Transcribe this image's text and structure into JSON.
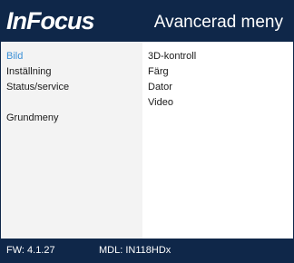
{
  "header": {
    "logo_text": "InFocus",
    "menu_title": "Avancerad meny"
  },
  "left_menu": {
    "items": [
      {
        "label": "Bild",
        "selected": true
      },
      {
        "label": "Inställning",
        "selected": false
      },
      {
        "label": "Status/service",
        "selected": false
      },
      {
        "label": "",
        "selected": false
      },
      {
        "label": "Grundmeny",
        "selected": false
      }
    ]
  },
  "right_menu": {
    "items": [
      {
        "label": "3D-kontroll"
      },
      {
        "label": "Färg"
      },
      {
        "label": "Dator"
      },
      {
        "label": "Video"
      }
    ]
  },
  "footer": {
    "fw": "FW: 4.1.27",
    "mdl": "MDL: IN118HDx"
  },
  "colors": {
    "header_bg": "#0f2749",
    "selected_text": "#3a8fd6",
    "left_pane_bg": "#f3f3f3"
  }
}
